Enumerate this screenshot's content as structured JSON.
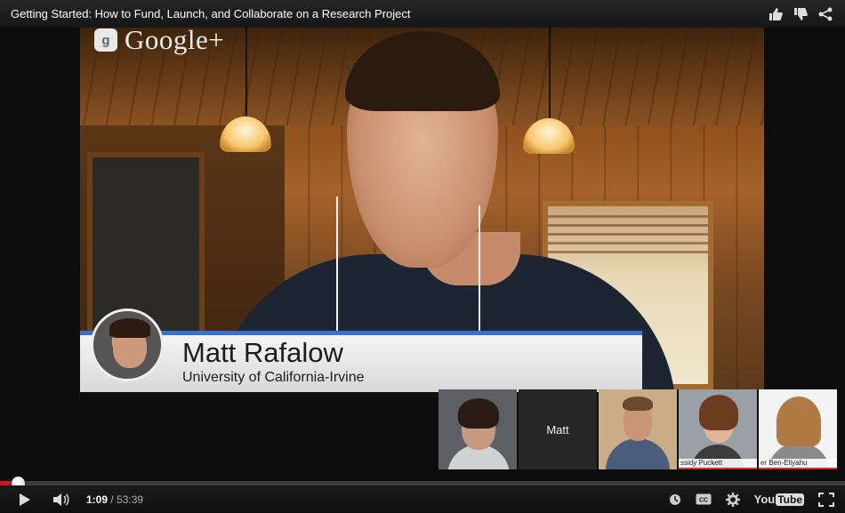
{
  "window": {
    "title": "Getting Started: How to Fund, Launch, and Collaborate on a Research Project"
  },
  "header_actions": [
    {
      "name": "like",
      "icon": "thumbs-up-icon"
    },
    {
      "name": "dislike",
      "icon": "thumbs-down-icon"
    },
    {
      "name": "share",
      "icon": "share-icon"
    }
  ],
  "overlay": {
    "brand": "Google+",
    "brand_badge": "g"
  },
  "speaker": {
    "name": "Matt Rafalow",
    "org": "University of California-Irvine"
  },
  "participants": [
    {
      "label": "",
      "kind": "video"
    },
    {
      "label": "Matt",
      "kind": "name-tile"
    },
    {
      "label": "",
      "kind": "video"
    },
    {
      "label": "ssidy Puckett",
      "kind": "video"
    },
    {
      "label": "er Ben-Eliyahu",
      "kind": "video"
    }
  ],
  "player": {
    "current_time": "1:09",
    "duration": "53:39",
    "separator": "/",
    "progress_fraction": 0.0214,
    "buffered_fraction": 0.028,
    "youtube_logo_you": "You",
    "youtube_logo_tube": "Tube"
  },
  "colors": {
    "accent_blue": "#3570d6",
    "progress_red": "#cc181e",
    "participant_bar_red": "#d4312b"
  },
  "icons": {
    "play": "play-icon",
    "volume": "volume-icon",
    "watch_later": "clock-icon",
    "captions": "cc-icon",
    "settings": "gear-icon",
    "fullscreen": "fullscreen-icon"
  }
}
